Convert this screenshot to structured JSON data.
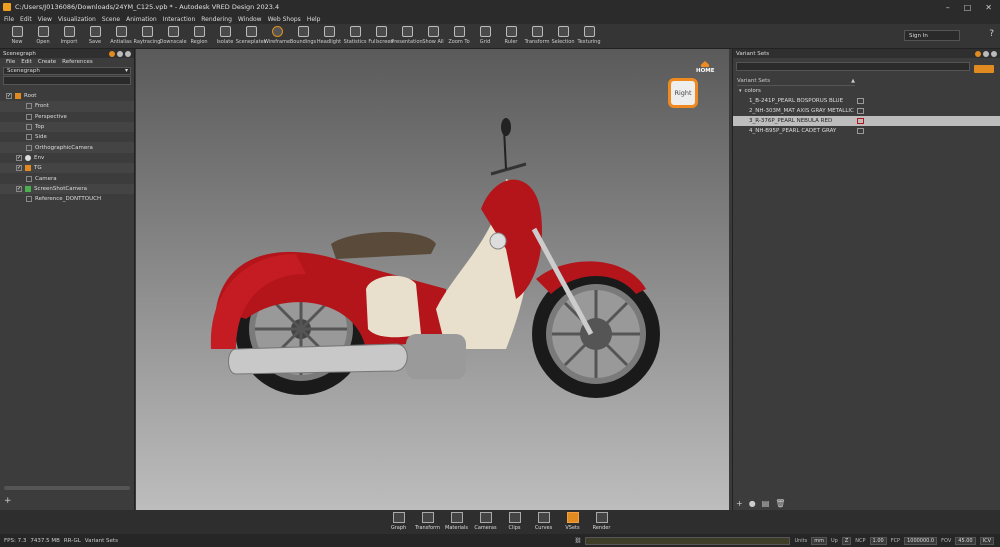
{
  "window": {
    "title": "C:/Users/J0136086/Downloads/24YM_C125.vpb * - Autodesk VRED Design 2023.4",
    "min": "–",
    "max": "□",
    "close": "✕"
  },
  "menu": [
    "File",
    "Edit",
    "View",
    "Visualization",
    "Scene",
    "Animation",
    "Interaction",
    "Rendering",
    "Window",
    "Web Shops",
    "Help"
  ],
  "toolbar": [
    "New",
    "Open",
    "Import",
    "Save",
    "Antialias",
    "Raytracing",
    "Downscale",
    "Region",
    "Isolate",
    "Sceneplates",
    "Wireframe",
    "Boundings",
    "Headlight",
    "Statistics",
    "Fullscreen",
    "Presentation",
    "Show All",
    "Zoom To",
    "Grid",
    "Ruler",
    "Transform",
    "Selection",
    "Texturing"
  ],
  "signin": "Sign In",
  "help": "?",
  "scenegraph": {
    "title": "Scenegraph",
    "menu": [
      "File",
      "Edit",
      "Create",
      "References"
    ],
    "selector": "Scenegraph",
    "nodes": [
      {
        "label": "Root",
        "checked": "✓"
      },
      {
        "label": "Front",
        "checked": ""
      },
      {
        "label": "Perspective",
        "checked": ""
      },
      {
        "label": "Top",
        "checked": ""
      },
      {
        "label": "Side",
        "checked": ""
      },
      {
        "label": "OrthographicCamera",
        "checked": ""
      },
      {
        "label": "Env",
        "checked": "✓"
      },
      {
        "label": "TG",
        "checked": "✓"
      },
      {
        "label": "Camera",
        "checked": ""
      },
      {
        "label": "ScreenShotCamera",
        "checked": "✓"
      },
      {
        "label": "Reference_DONTTOUCH",
        "checked": ""
      }
    ]
  },
  "viewport": {
    "navcube_face": "Right",
    "home_label": "HOME"
  },
  "variantsets": {
    "title": "Variant Sets",
    "column": "Variant Sets",
    "group": "colors",
    "items": [
      {
        "label": "1_B-241P_PEARL BOSPORUS BLUE",
        "selected": false
      },
      {
        "label": "2_NH-303M_MAT AXIS GRAY METALLIC",
        "selected": false
      },
      {
        "label": "3_R-376P_PEARL NEBULA RED",
        "selected": true
      },
      {
        "label": "4_NH-B95P_PEARL CADET GRAY",
        "selected": false
      }
    ]
  },
  "dock": [
    {
      "label": "Graph",
      "active": false
    },
    {
      "label": "Transform",
      "active": false
    },
    {
      "label": "Materials",
      "active": false
    },
    {
      "label": "Cameras",
      "active": false
    },
    {
      "label": "Clips",
      "active": false
    },
    {
      "label": "Curves",
      "active": false
    },
    {
      "label": "VSets",
      "active": true
    },
    {
      "label": "Render",
      "active": false
    }
  ],
  "status": {
    "fps": "FPS: 7.3",
    "mem": "7437.5 MB",
    "renderer": "RR-GL",
    "module": "Variant Sets",
    "units_label": "Units",
    "units": "mm",
    "up_label": "Up",
    "up": "Z",
    "ncp_label": "NCP",
    "ncp": "1.00",
    "fcp_label": "FCP",
    "fcp": "1000000.0",
    "fov_label": "FOV",
    "fov": "45.00",
    "icv": "ICV"
  },
  "colors": {
    "accent": "#e08a20",
    "body_red": "#b3151b",
    "body_cream": "#e8e0cc"
  }
}
